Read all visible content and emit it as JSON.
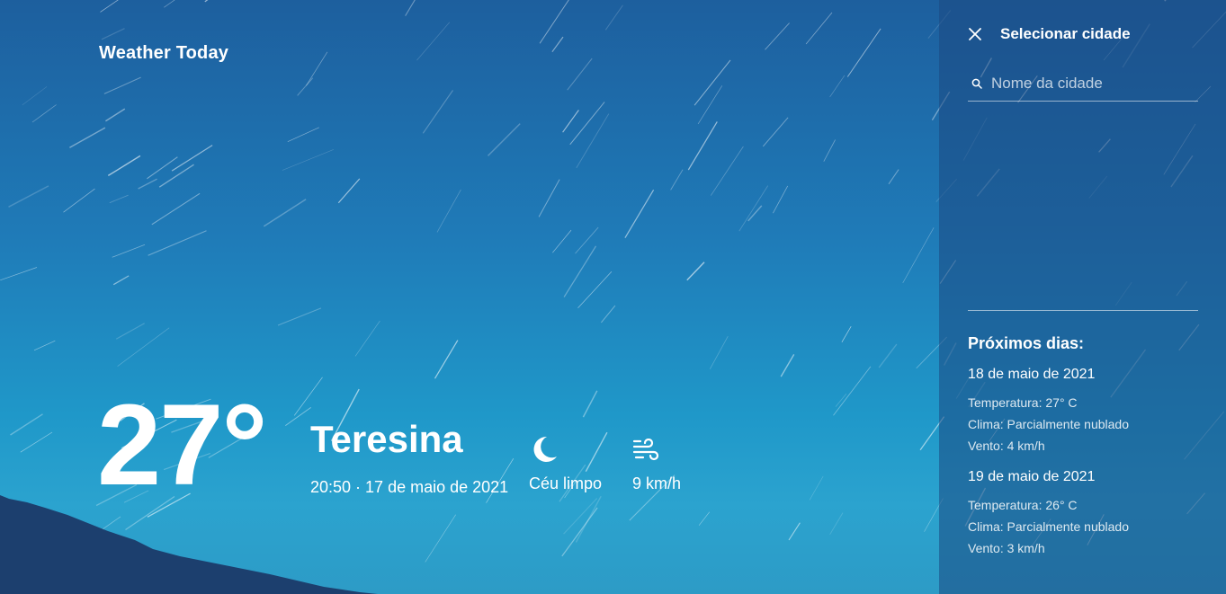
{
  "app": {
    "title": "Weather Today"
  },
  "current": {
    "temperature": "27°",
    "city": "Teresina",
    "datetime": "20:50 · 17 de maio de 2021",
    "condition": {
      "label": "Céu limpo",
      "icon": "moon-icon"
    },
    "wind": {
      "label": "9 km/h",
      "icon": "wind-icon"
    }
  },
  "sidebar": {
    "title": "Selecionar cidade",
    "search_placeholder": "Nome da cidade",
    "next_days_title": "Próximos dias:",
    "days": [
      {
        "date": "18 de maio de 2021",
        "temperature": "Temperatura: 27° C",
        "climate": "Clima: Parcialmente nublado",
        "wind": "Vento: 4 km/h"
      },
      {
        "date": "19 de maio de 2021",
        "temperature": "Temperatura: 26° C",
        "climate": "Clima: Parcialmente nublado",
        "wind": "Vento: 3 km/h"
      }
    ]
  },
  "colors": {
    "sky_top": "#1d5f9e",
    "sky_bottom": "#2ba3cf",
    "sidebar": "#1c4882",
    "text": "#ffffff"
  }
}
